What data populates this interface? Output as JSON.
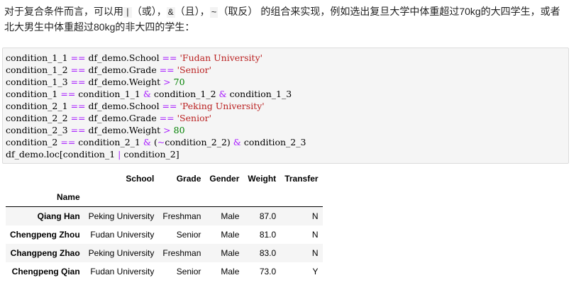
{
  "intro": {
    "line1_a": "对于复合条件而言，可以用",
    "op_or": "|",
    "paren_or": "（或），",
    "op_and": "&",
    "paren_and": "（且），",
    "op_not": "~",
    "paren_not": "（取反）",
    "line1_b": "的组合来实现，例如选出复旦大学中体重超过70kg的大四学生，或者",
    "line2": "北大男生中体重超过80kg的非大四的学生："
  },
  "code": {
    "lines": [
      [
        {
          "t": "condition_1_1 "
        },
        {
          "t": "==",
          "c": "op"
        },
        {
          "t": " df_demo.School "
        },
        {
          "t": "==",
          "c": "op"
        },
        {
          "t": " "
        },
        {
          "t": "'Fudan University'",
          "c": "str"
        }
      ],
      [
        {
          "t": "condition_1_2 "
        },
        {
          "t": "==",
          "c": "op"
        },
        {
          "t": " df_demo.Grade "
        },
        {
          "t": "==",
          "c": "op"
        },
        {
          "t": " "
        },
        {
          "t": "'Senior'",
          "c": "str"
        }
      ],
      [
        {
          "t": "condition_1_3 "
        },
        {
          "t": "==",
          "c": "op"
        },
        {
          "t": " df_demo.Weight "
        },
        {
          "t": ">",
          "c": "op"
        },
        {
          "t": " "
        },
        {
          "t": "70",
          "c": "num"
        }
      ],
      [
        {
          "t": "condition_1 "
        },
        {
          "t": "==",
          "c": "op"
        },
        {
          "t": " condition_1_1 "
        },
        {
          "t": "&",
          "c": "op"
        },
        {
          "t": " condition_1_2 "
        },
        {
          "t": "&",
          "c": "op"
        },
        {
          "t": " condition_1_3"
        }
      ],
      [
        {
          "t": "condition_2_1 "
        },
        {
          "t": "==",
          "c": "op"
        },
        {
          "t": " df_demo.School "
        },
        {
          "t": "==",
          "c": "op"
        },
        {
          "t": " "
        },
        {
          "t": "'Peking University'",
          "c": "str"
        }
      ],
      [
        {
          "t": "condition_2_2 "
        },
        {
          "t": "==",
          "c": "op"
        },
        {
          "t": " df_demo.Grade "
        },
        {
          "t": "==",
          "c": "op"
        },
        {
          "t": " "
        },
        {
          "t": "'Senior'",
          "c": "str"
        }
      ],
      [
        {
          "t": "condition_2_3 "
        },
        {
          "t": "==",
          "c": "op"
        },
        {
          "t": " df_demo.Weight "
        },
        {
          "t": ">",
          "c": "op"
        },
        {
          "t": " "
        },
        {
          "t": "80",
          "c": "num"
        }
      ],
      [
        {
          "t": "condition_2 "
        },
        {
          "t": "==",
          "c": "op"
        },
        {
          "t": " condition_2_1 "
        },
        {
          "t": "&",
          "c": "op"
        },
        {
          "t": " ("
        },
        {
          "t": "~",
          "c": "op"
        },
        {
          "t": "condition_2_2) "
        },
        {
          "t": "&",
          "c": "op"
        },
        {
          "t": " condition_2_3"
        }
      ],
      [
        {
          "t": "df_demo.loc[condition_1 "
        },
        {
          "t": "|",
          "c": "op"
        },
        {
          "t": " condition_2]"
        }
      ]
    ]
  },
  "table": {
    "columns": [
      "School",
      "Grade",
      "Gender",
      "Weight",
      "Transfer"
    ],
    "index_name": "Name",
    "rows": [
      {
        "name": "Qiang Han",
        "values": [
          "Peking University",
          "Freshman",
          "Male",
          "87.0",
          "N"
        ]
      },
      {
        "name": "Chengpeng Zhou",
        "values": [
          "Fudan University",
          "Senior",
          "Male",
          "81.0",
          "N"
        ]
      },
      {
        "name": "Changpeng Zhao",
        "values": [
          "Peking University",
          "Freshman",
          "Male",
          "83.0",
          "N"
        ]
      },
      {
        "name": "Chengpeng Qian",
        "values": [
          "Fudan University",
          "Senior",
          "Male",
          "73.0",
          "Y"
        ]
      }
    ]
  }
}
